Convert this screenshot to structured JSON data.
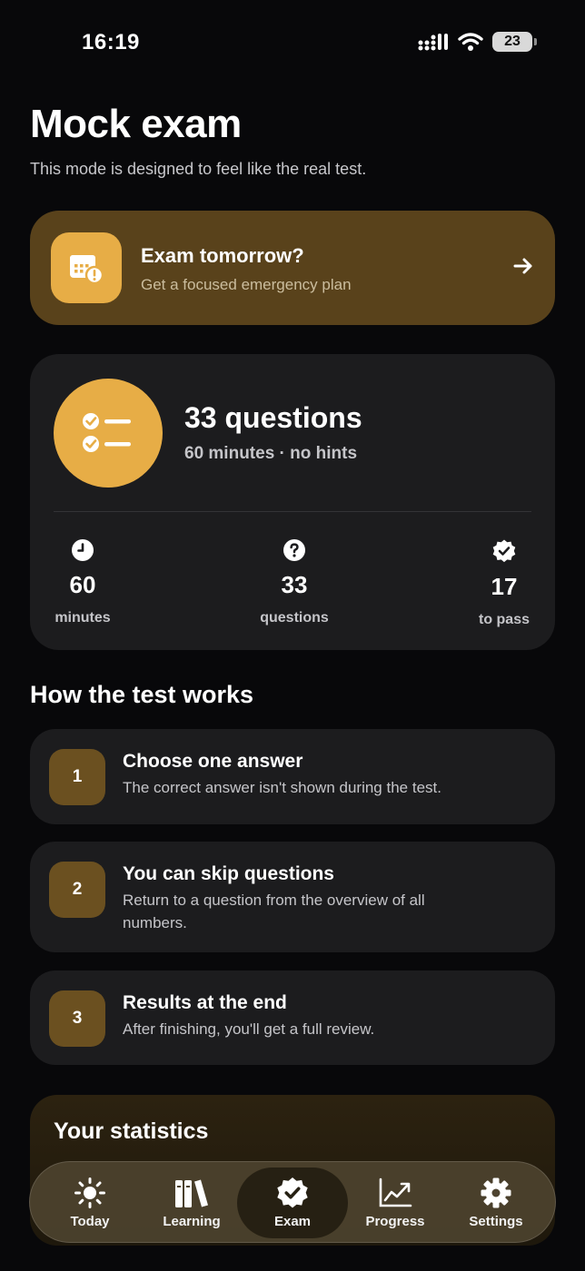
{
  "status": {
    "time": "16:19",
    "battery": "23"
  },
  "page": {
    "title": "Mock exam",
    "subtitle": "This mode is designed to feel like the real test."
  },
  "promo": {
    "title": "Exam tomorrow?",
    "subtitle": "Get a focused emergency plan"
  },
  "exam": {
    "title": "33 questions",
    "subtitle": "60 minutes · no hints",
    "stats": [
      {
        "value": "60",
        "label": "minutes"
      },
      {
        "value": "33",
        "label": "questions"
      },
      {
        "value": "17",
        "label": "to pass"
      }
    ]
  },
  "how": {
    "title": "How the test works",
    "steps": [
      {
        "num": "1",
        "title": "Choose one answer",
        "body": "The correct answer isn't shown during the test."
      },
      {
        "num": "2",
        "title": "You can skip questions",
        "body": "Return to a question from the overview of all numbers."
      },
      {
        "num": "3",
        "title": "Results at the end",
        "body": "After finishing, you'll get a full review."
      }
    ]
  },
  "statistics": {
    "title": "Your statistics"
  },
  "tabs": [
    {
      "label": "Today"
    },
    {
      "label": "Learning"
    },
    {
      "label": "Exam"
    },
    {
      "label": "Progress"
    },
    {
      "label": "Settings"
    }
  ],
  "colors": {
    "accent": "#e7ad46",
    "promo_bg": "#59421b",
    "card_bg": "#1c1c1e",
    "background": "#08080a"
  }
}
